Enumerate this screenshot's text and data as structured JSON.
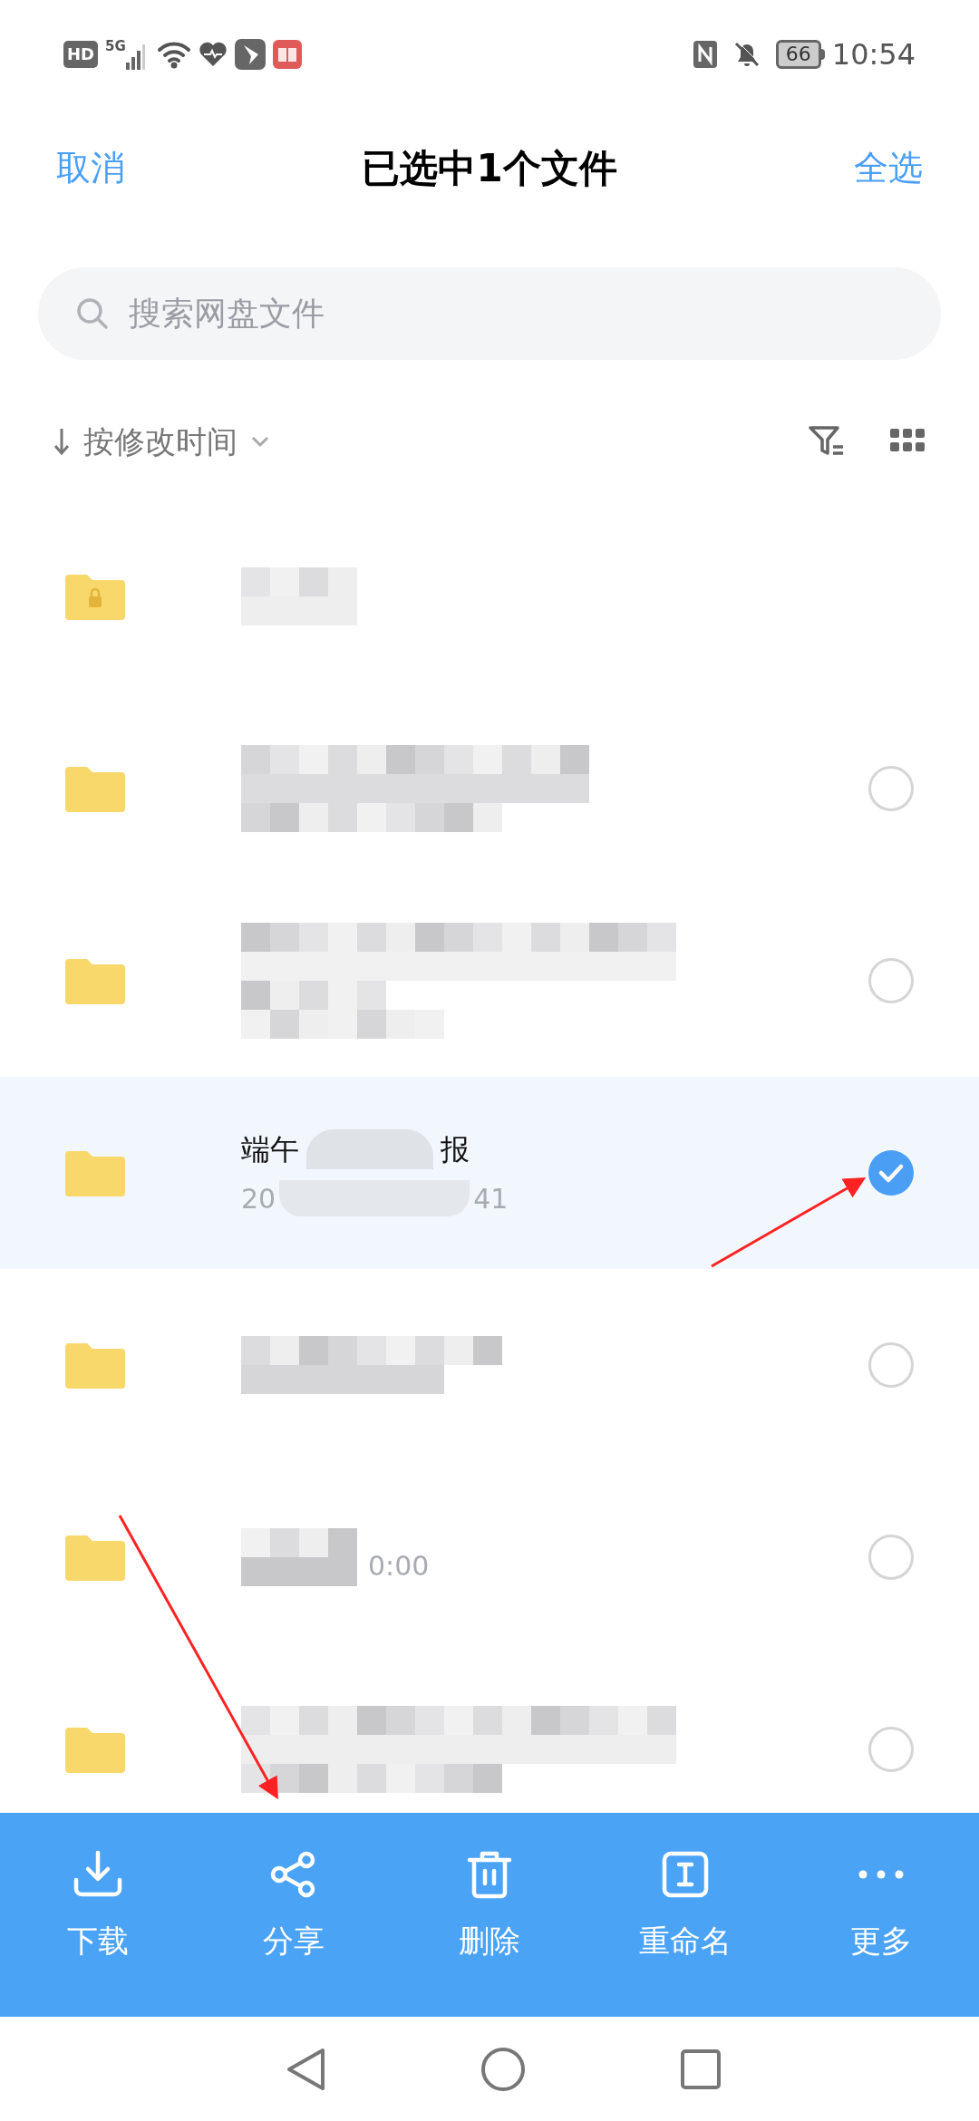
{
  "status_bar": {
    "hd": "HD",
    "network": "5G",
    "battery": "66",
    "time": "10:54"
  },
  "header": {
    "cancel": "取消",
    "title": "已选中1个文件",
    "select_all": "全选"
  },
  "search": {
    "placeholder": "搜索网盘文件"
  },
  "sort": {
    "label": "按修改时间"
  },
  "files": [
    {
      "kind": "locked",
      "selected": false
    },
    {
      "kind": "folder",
      "selected": false
    },
    {
      "kind": "folder",
      "selected": false
    },
    {
      "kind": "folder",
      "selected": true,
      "title_start": "端午",
      "title_end": "报",
      "date_start": "20",
      "date_end": "41"
    },
    {
      "kind": "folder",
      "selected": false
    },
    {
      "kind": "folder",
      "selected": false,
      "date_end": "0:00"
    },
    {
      "kind": "folder",
      "selected": false
    }
  ],
  "actions": [
    {
      "kind": "download",
      "label": "下载"
    },
    {
      "kind": "share",
      "label": "分享"
    },
    {
      "kind": "delete",
      "label": "删除"
    },
    {
      "kind": "rename",
      "label": "重命名"
    },
    {
      "kind": "more",
      "label": "更多"
    }
  ]
}
